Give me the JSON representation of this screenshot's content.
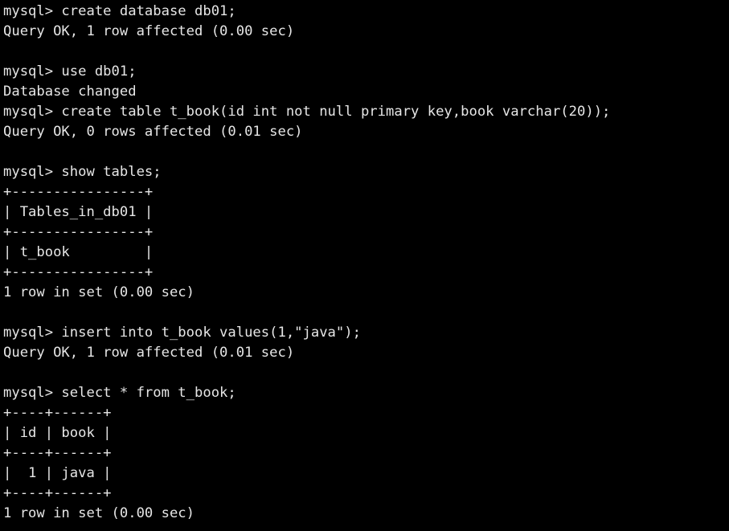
{
  "terminal": {
    "app": "mysql-client",
    "background_color": "#000000",
    "text_color": "#e6e6e6",
    "prompt": "mysql>",
    "lines": [
      "mysql> create database db01;",
      "Query OK, 1 row affected (0.00 sec)",
      "",
      "mysql> use db01;",
      "Database changed",
      "mysql> create table t_book(id int not null primary key,book varchar(20));",
      "Query OK, 0 rows affected (0.01 sec)",
      "",
      "mysql> show tables;",
      "+----------------+",
      "| Tables_in_db01 |",
      "+----------------+",
      "| t_book         |",
      "+----------------+",
      "1 row in set (0.00 sec)",
      "",
      "mysql> insert into t_book values(1,\"java\");",
      "Query OK, 1 row affected (0.01 sec)",
      "",
      "mysql> select * from t_book;",
      "+----+------+",
      "| id | book |",
      "+----+------+",
      "|  1 | java |",
      "+----+------+",
      "1 row in set (0.00 sec)"
    ],
    "commands": [
      "create database db01;",
      "use db01;",
      "create table t_book(id int not null primary key,book varchar(20));",
      "show tables;",
      "insert into t_book values(1,\"java\");",
      "select * from t_book;"
    ],
    "results": [
      "Query OK, 1 row affected (0.00 sec)",
      "Database changed",
      "Query OK, 0 rows affected (0.01 sec)",
      "1 row in set (0.00 sec)",
      "Query OK, 1 row affected (0.01 sec)",
      "1 row in set (0.00 sec)"
    ],
    "tables": [
      {
        "name": "show-tables-result",
        "columns": [
          "Tables_in_db01"
        ],
        "rows": [
          [
            "t_book"
          ]
        ],
        "footer": "1 row in set (0.00 sec)"
      },
      {
        "name": "select-t-book-result",
        "columns": [
          "id",
          "book"
        ],
        "rows": [
          [
            "1",
            "java"
          ]
        ],
        "footer": "1 row in set (0.00 sec)"
      }
    ],
    "database_name": "db01",
    "table_name": "t_book"
  }
}
